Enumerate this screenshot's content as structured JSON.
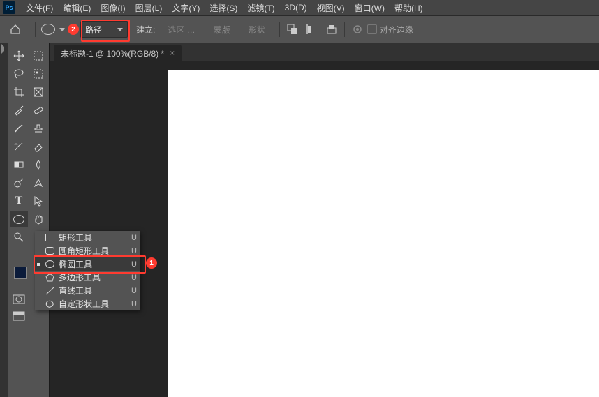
{
  "menu": {
    "file": "文件(F)",
    "edit": "编辑(E)",
    "image": "图像(I)",
    "layer": "图层(L)",
    "type": "文字(Y)",
    "select": "选择(S)",
    "filter": "滤镜(T)",
    "threeD": "3D(D)",
    "view": "视图(V)",
    "window": "窗口(W)",
    "help": "帮助(H)"
  },
  "optbar": {
    "mode": "路径",
    "establish": "建立:",
    "selectBtn": "选区 …",
    "maskBtn": "蒙版",
    "shapeBtn": "形状",
    "alignEdges": "对齐边缘"
  },
  "annot": {
    "badge1": "1",
    "badge2": "2"
  },
  "tab": {
    "title": "未标题-1 @ 100%(RGB/8) *"
  },
  "flyout": {
    "items": [
      {
        "label": "矩形工具",
        "key": "U"
      },
      {
        "label": "圆角矩形工具",
        "key": "U"
      },
      {
        "label": "椭圆工具",
        "key": "U"
      },
      {
        "label": "多边形工具",
        "key": "U"
      },
      {
        "label": "直线工具",
        "key": "U"
      },
      {
        "label": "自定形状工具",
        "key": "U"
      }
    ]
  }
}
